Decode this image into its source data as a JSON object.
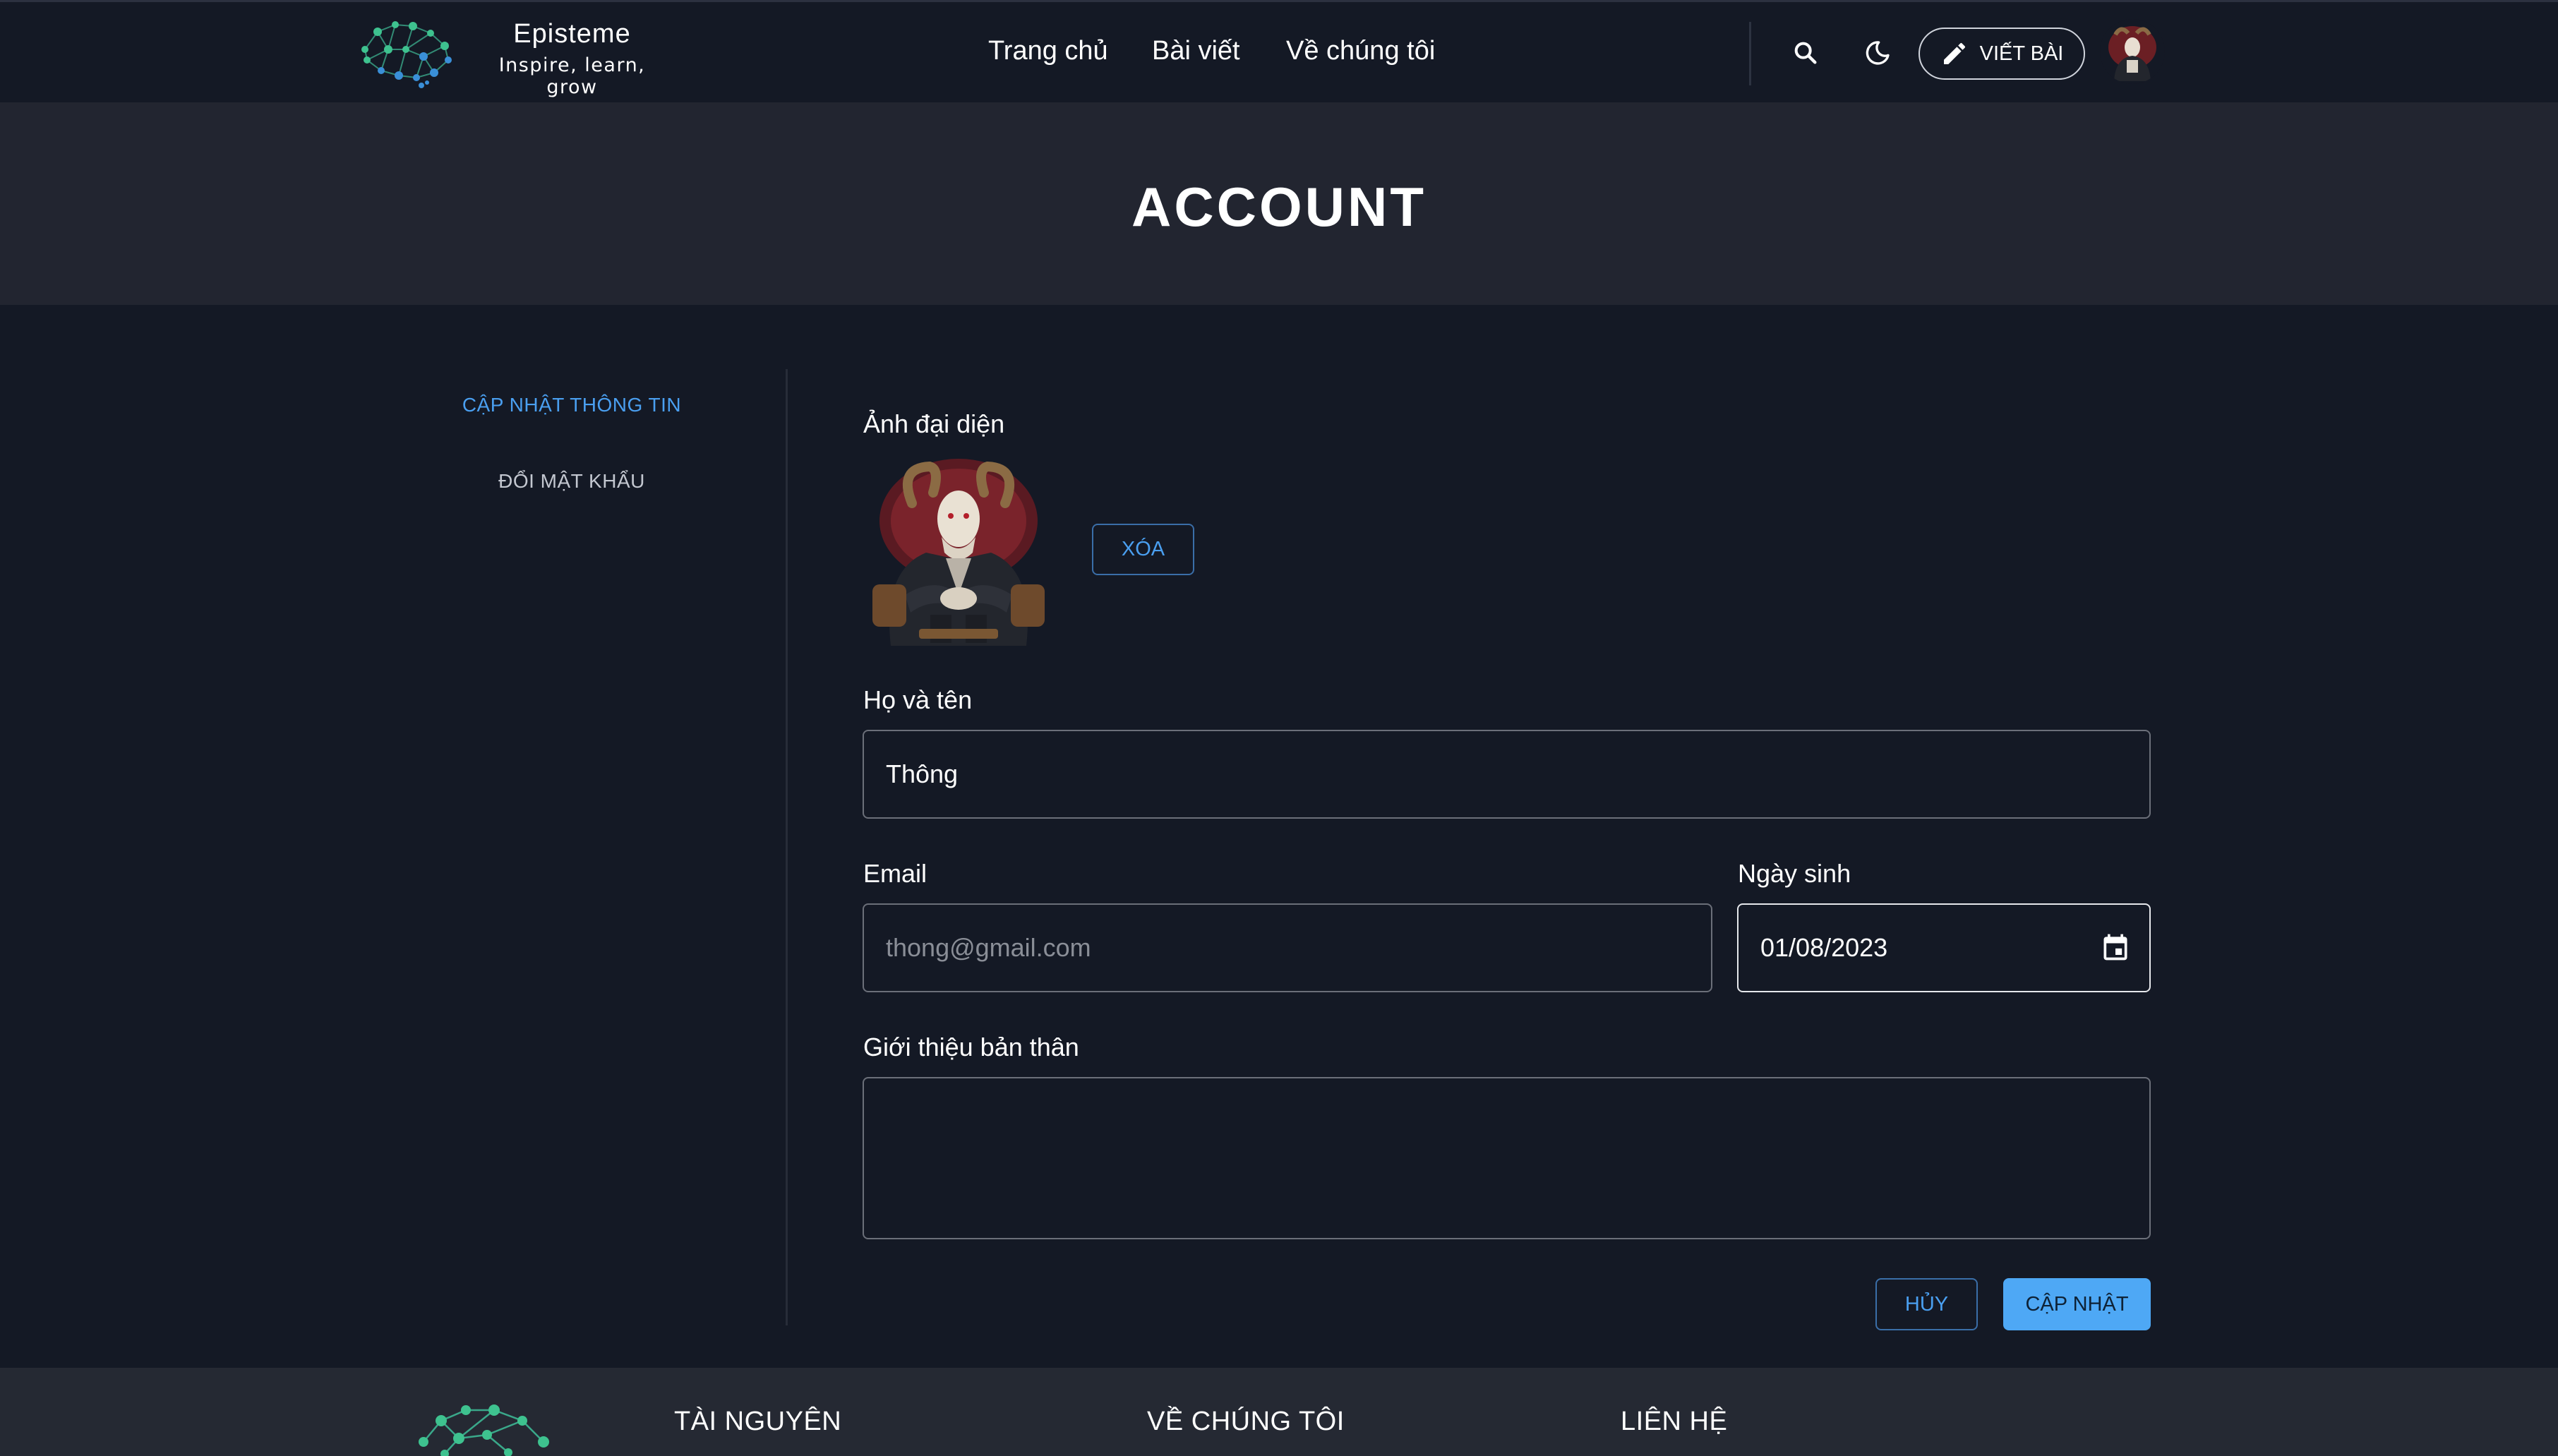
{
  "header": {
    "brand_name": "Episteme",
    "brand_tagline": "Inspire, learn, grow",
    "nav": [
      "Trang chủ",
      "Bài viết",
      "Về chúng tôi"
    ],
    "write_label": "VIẾT BÀI"
  },
  "banner": {
    "title": "ACCOUNT"
  },
  "sidebar": {
    "items": [
      {
        "label": "CẬP NHẬT THÔNG TIN",
        "active": true
      },
      {
        "label": "ĐỔI MẬT KHẨU",
        "active": false
      }
    ]
  },
  "form": {
    "avatar_label": "Ảnh đại diện",
    "delete_label": "XÓA",
    "fullname_label": "Họ và tên",
    "fullname_value": "Thông",
    "email_label": "Email",
    "email_value": "thong@gmail.com",
    "birthday_label": "Ngày sinh",
    "birthday_value": "01/08/2023",
    "bio_label": "Giới thiệu bản thân",
    "bio_value": "",
    "cancel_label": "HỦY",
    "submit_label": "CẬP NHẬT"
  },
  "footer": {
    "columns": [
      "TÀI NGUYÊN",
      "VỀ CHÚNG TÔI",
      "LIÊN HỆ"
    ]
  },
  "colors": {
    "page_bg": "#141925",
    "banner_bg": "#222530",
    "footer_bg": "#252933",
    "accent": "#4a9ff0",
    "primary_button": "#4ea8f5",
    "logo_green": "#3ec28f",
    "logo_blue": "#3a8fd8"
  }
}
